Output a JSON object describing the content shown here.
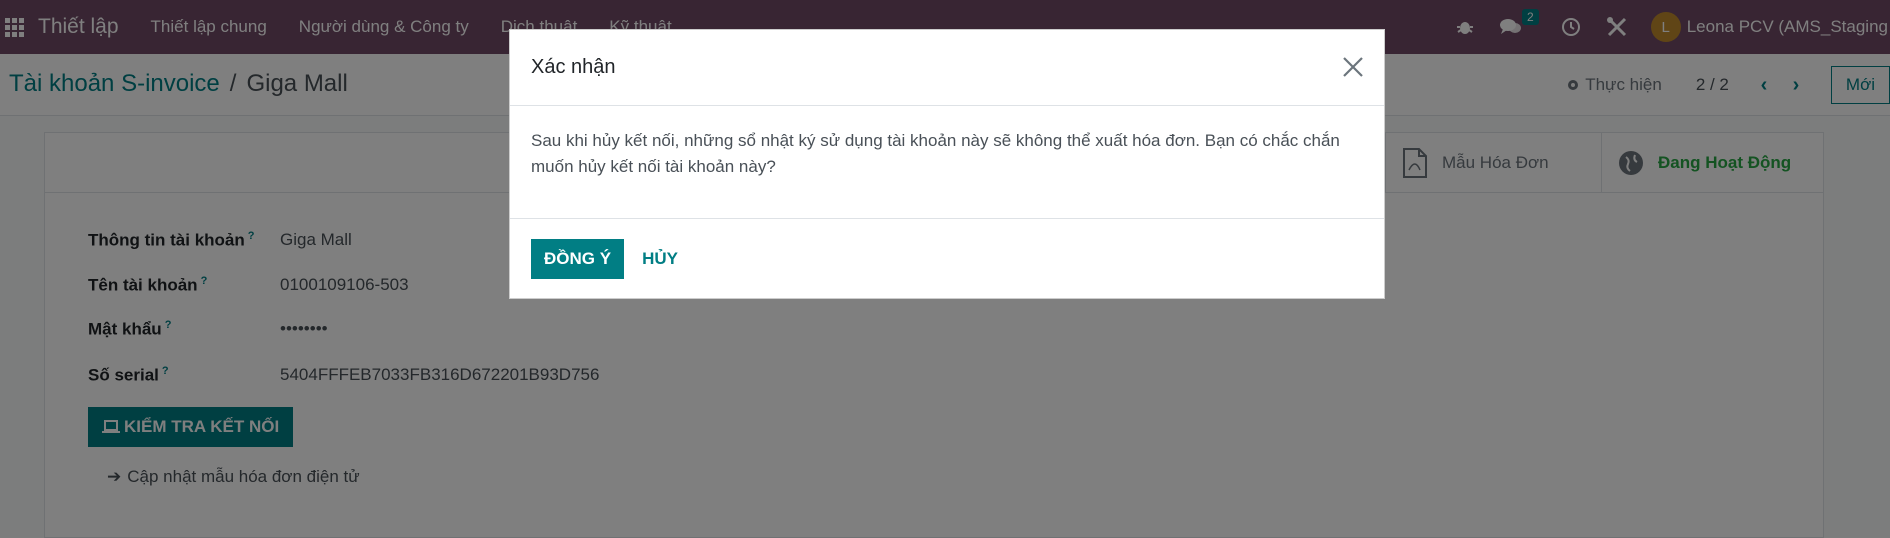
{
  "navbar": {
    "brand": "Thiết lập",
    "menu": [
      "Thiết lập chung",
      "Người dùng & Công ty",
      "Dịch thuật",
      "Kỹ thuật"
    ],
    "chat_badge": "2",
    "user_initial": "L",
    "user_name": "Leona PCV (AMS_Staging"
  },
  "control_panel": {
    "breadcrumb_parent": "Tài khoản S-invoice",
    "breadcrumb_separator": "/",
    "breadcrumb_current": "Giga Mall",
    "action_label": "Thực hiện",
    "pager": "2 / 2",
    "new_button": "Mới"
  },
  "form": {
    "stat_buttons": {
      "template_label": "Mẫu Hóa Đơn",
      "active_label": "Đang Hoạt Động"
    },
    "fields": [
      {
        "label": "Thông tin tài khoản",
        "help": "?",
        "value": "Giga Mall"
      },
      {
        "label": "Tên tài khoản",
        "help": "?",
        "value": "0100109106-503"
      },
      {
        "label": "Mật khẩu",
        "help": "?",
        "value": "••••••••"
      },
      {
        "label": "Số serial",
        "help": "?",
        "value": "5404FFFEB7033FB316D672201B93D756"
      }
    ],
    "check_button": "KIỂM TRA KẾT NỐI",
    "update_link": "Cập nhật mẫu hóa đơn điện tử"
  },
  "modal": {
    "title": "Xác nhận",
    "body": "Sau khi hủy kết nối, những sổ nhật ký sử dụng tài khoản này sẽ không thể xuất hóa đơn. Bạn có chắc chắn muốn hủy kết nối tài khoản này?",
    "ok_button": "ĐỒNG Ý",
    "cancel_button": "HỦY"
  },
  "colors": {
    "navbar": "#714b67",
    "primary": "#017e84",
    "active_status": "#28a745"
  }
}
